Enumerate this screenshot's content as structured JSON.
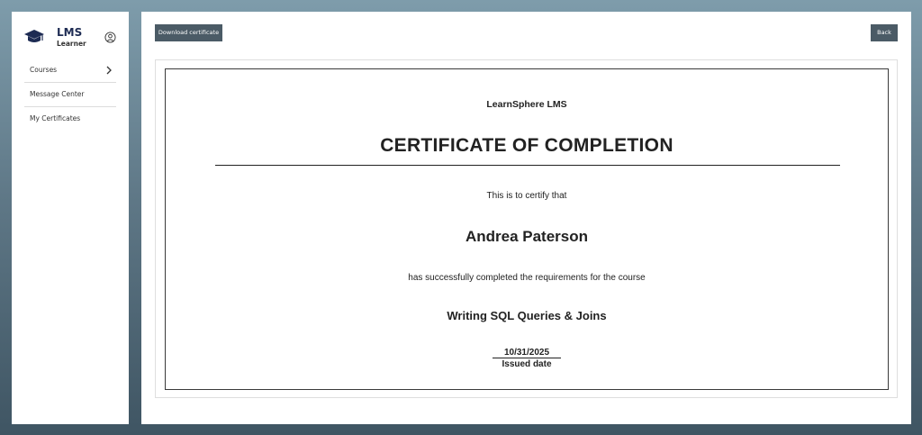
{
  "sidebar": {
    "brand_title": "LMS",
    "brand_role": "Learner",
    "brand_icon": "graduation-cap-icon",
    "user_icon": "user-circle-icon",
    "items": [
      {
        "label": "Courses",
        "icon": "chevron-right-icon"
      },
      {
        "label": "Message Center"
      },
      {
        "label": "My Certificates"
      }
    ]
  },
  "toolbar": {
    "download_label": "Download certificate",
    "back_label": "Back"
  },
  "certificate": {
    "organization": "LearnSphere LMS",
    "title": "CERTIFICATE OF COMPLETION",
    "intro": "This is to certify that",
    "recipient": "Andrea Paterson",
    "statement": "has successfully completed the requirements for the course",
    "course": "Writing SQL Queries & Joins",
    "issued_date": "10/31/2025",
    "issued_label": "Issued date"
  },
  "colors": {
    "brand": "#1d2b53",
    "button": "#4b5b66",
    "background_top": "#7e9cab",
    "background_bottom": "#3f5563"
  }
}
